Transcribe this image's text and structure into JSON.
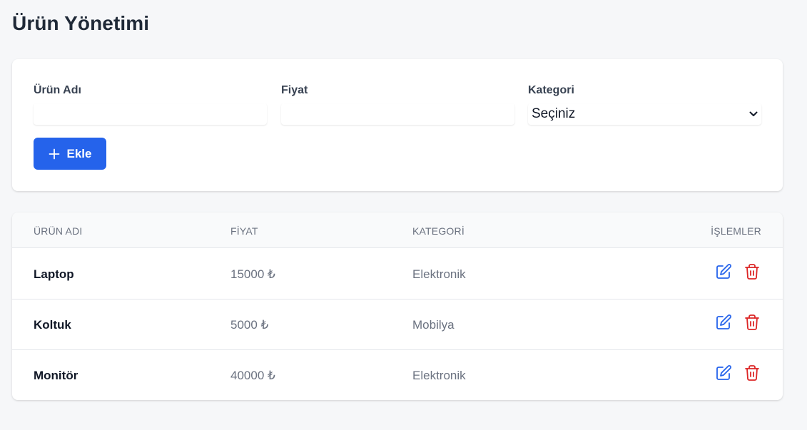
{
  "page": {
    "title": "Ürün Yönetimi"
  },
  "form": {
    "name_label": "Ürün Adı",
    "name_value": "",
    "price_label": "Fiyat",
    "price_value": "",
    "category_label": "Kategori",
    "category_selected": "Seçiniz",
    "add_button_label": "Ekle",
    "add_icon": "plus-icon"
  },
  "table": {
    "headers": [
      "ÜRÜN ADI",
      "FİYAT",
      "KATEGORİ",
      "İŞLEMLER"
    ],
    "rows": [
      {
        "name": "Laptop",
        "price": "15000 ₺",
        "category": "Elektronik"
      },
      {
        "name": "Koltuk",
        "price": "5000 ₺",
        "category": "Mobilya"
      },
      {
        "name": "Monitör",
        "price": "40000 ₺",
        "category": "Elektronik"
      }
    ],
    "edit_icon": "edit-icon",
    "delete_icon": "trash-icon"
  },
  "colors": {
    "primary": "#2563eb",
    "danger": "#dc2626",
    "background": "#f6f7f9"
  }
}
